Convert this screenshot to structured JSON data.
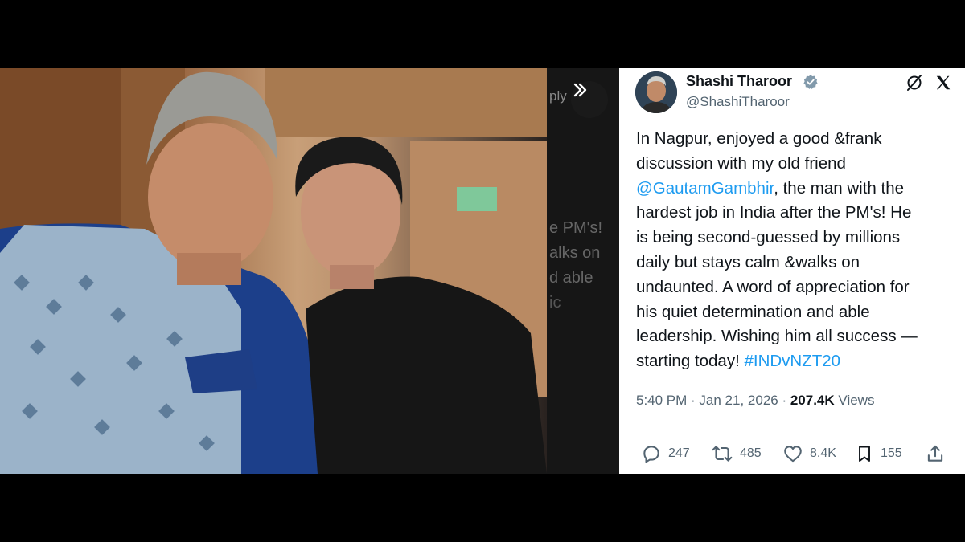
{
  "photo": {
    "overlay_fragments": [
      "ply",
      "e PM's!",
      "alks on",
      "d able",
      "ic"
    ],
    "next_button_icon": "chevron-double-right-icon"
  },
  "tweet": {
    "author_name": "Shashi Tharoor",
    "handle": "@ShashiTharoor",
    "text_part1": "In Nagpur, enjoyed a good &frank\ndiscussion with my old friend\n",
    "mention": "@GautamGambhir",
    "text_part2": ", the man with the\nhardest job in India after the PM's! He\nis being second-guessed by millions\ndaily but stays calm &walks on\nundaunted. A word of appreciation for\nhis quiet determination and able\nleadership. Wishing him all success —\nstarting today! ",
    "hashtag": "#INDvNZT20",
    "time": "5:40 PM",
    "date": "Jan 21, 2026",
    "views_count": "207.4K",
    "views_label": "Views",
    "replies": "247",
    "reposts": "485",
    "likes": "8.4K",
    "bookmarks": "155",
    "colors": {
      "link": "#1d9bf0",
      "muted": "#536471",
      "verified": "#829aab"
    }
  }
}
